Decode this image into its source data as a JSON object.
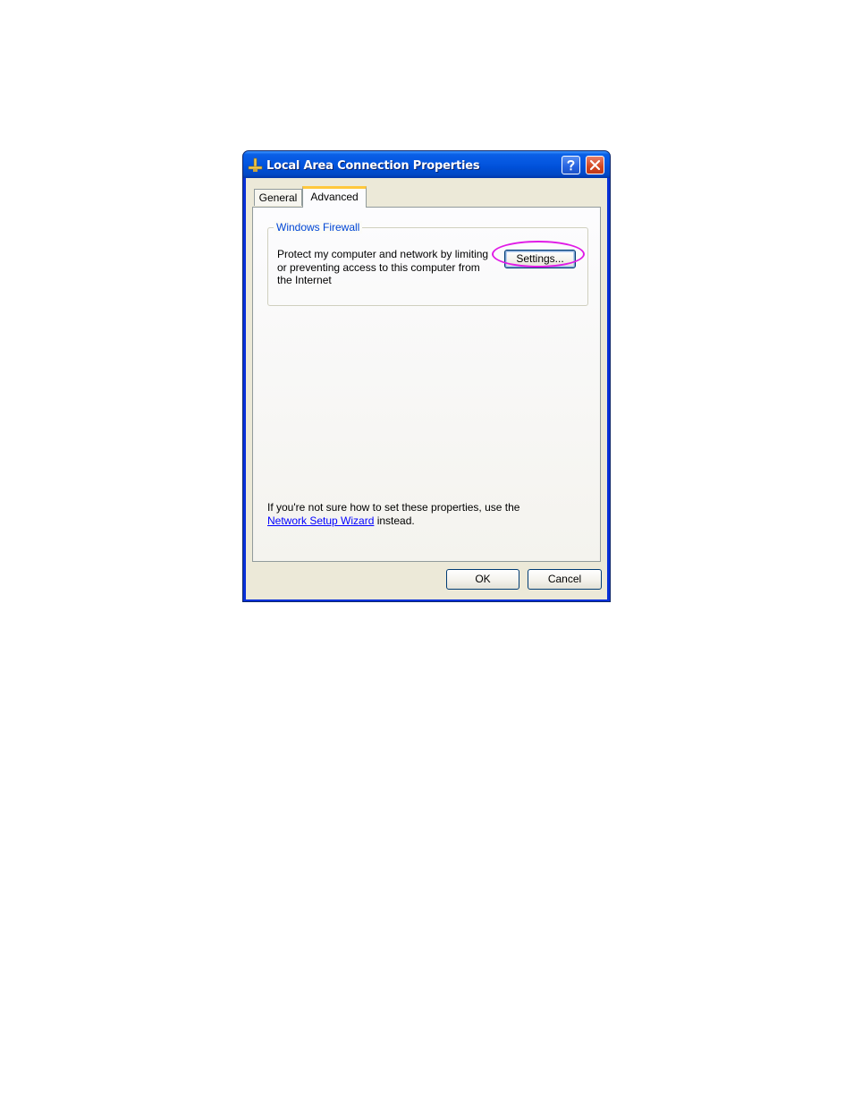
{
  "window": {
    "title": "Local Area Connection Properties",
    "icon": "network-connection-icon",
    "controls": {
      "help": "help-icon",
      "close": "close-icon"
    }
  },
  "tabs": [
    {
      "label": "General",
      "selected": false
    },
    {
      "label": "Advanced",
      "selected": true
    }
  ],
  "firewall_group": {
    "legend": "Windows Firewall",
    "description": "Protect my computer and network by limiting or preventing access to this computer from the Internet",
    "settings_button": "Settings...",
    "highlight_color": "#e01be6"
  },
  "help": {
    "prefix": "If you're not sure how to set these properties, use the ",
    "link": "Network Setup Wizard",
    "suffix": " instead."
  },
  "footer": {
    "ok": "OK",
    "cancel": "Cancel"
  }
}
